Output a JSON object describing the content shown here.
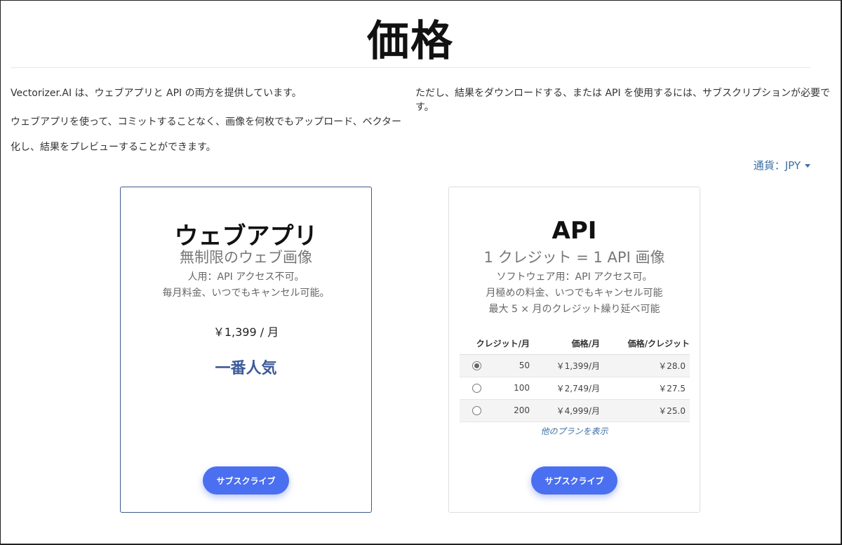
{
  "page": {
    "title": "価格",
    "intro_1": "Vectorizer.AI は、ウェブアプリと API の両方を提供しています。",
    "intro_2": "ウェブアプリを使って、コミットすることなく、画像を何枚でもアップロード、ベクター化し、結果をプレビューすることができます。",
    "intro_3": "ただし、結果をダウンロードする、または API を使用するには、サブスクリプションが必要です。",
    "currency_label": "通貨：JPY"
  },
  "web_card": {
    "title": "ウェブアプリ",
    "subtitle": "無制限のウェブ画像",
    "desc_1": "人用：API アクセス不可。",
    "desc_2": "毎月料金、いつでもキャンセル可能。",
    "price": "￥1,399 / 月",
    "badge": "一番人気",
    "button": "サブスクライブ"
  },
  "api_card": {
    "title": "API",
    "subtitle": "1 クレジット = 1 API 画像",
    "desc_1": "ソフトウェア用：API アクセス可。",
    "desc_2": "月極めの料金、いつでもキャンセル可能",
    "desc_3": "最大 5 × 月のクレジット繰り延べ可能",
    "table": {
      "headers": [
        "クレジット/月",
        "価格/月",
        "価格/クレジット"
      ],
      "rows": [
        {
          "credits": "50",
          "price_month": "￥1,399/月",
          "price_credit": "￥28.0",
          "selected": true
        },
        {
          "credits": "100",
          "price_month": "￥2,749/月",
          "price_credit": "￥27.5",
          "selected": false
        },
        {
          "credits": "200",
          "price_month": "￥4,999/月",
          "price_credit": "￥25.0",
          "selected": false
        }
      ]
    },
    "more_plans": "他のプランを表示",
    "button": "サブスクライブ"
  },
  "colors": {
    "accent_button": "#4a6ff0",
    "popular_text": "#3d5a9a",
    "link": "#3b6ea5"
  }
}
